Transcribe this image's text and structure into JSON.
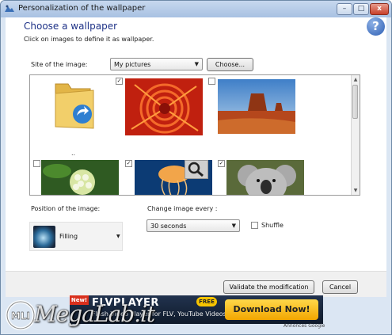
{
  "window": {
    "title": "Personalization of the wallpaper",
    "min": "–",
    "max": "□",
    "close": "x"
  },
  "header": {
    "heading": "Choose a wallpaper",
    "subtitle": "Click on images to define it as wallpaper.",
    "help": "?"
  },
  "site": {
    "label": "Site of the image:",
    "value": "My pictures",
    "choose_label": "Choose..."
  },
  "gallery": {
    "folder_caption": "..",
    "items": [
      {
        "kind": "folder",
        "checked": false
      },
      {
        "kind": "flower-red",
        "checked": true
      },
      {
        "kind": "desert",
        "checked": false
      },
      {
        "kind": "hydrangea",
        "checked": false
      },
      {
        "kind": "jellyfish",
        "checked": true
      },
      {
        "kind": "koala",
        "checked": true
      }
    ]
  },
  "position": {
    "label": "Position of the image:",
    "value": "Filling"
  },
  "interval": {
    "label": "Change image every :",
    "value": "30 seconds",
    "shuffle_label": "Shuffle",
    "shuffle_checked": false
  },
  "footer": {
    "validate_label": "Validate the modification",
    "cancel_label": "Cancel"
  },
  "ad": {
    "new_badge": "New!",
    "title": "FLVPLAYER",
    "free_badge": "FREE",
    "line": "Flash Video Player for FLV, YouTube Videos.",
    "download_label": "Download Now!",
    "google": "Annonces Google"
  },
  "watermark": {
    "text": "MegaLab.it"
  },
  "colors": {
    "accent": "#1e3287",
    "titlebar": "#a8c1e2",
    "close": "#c8402a"
  }
}
